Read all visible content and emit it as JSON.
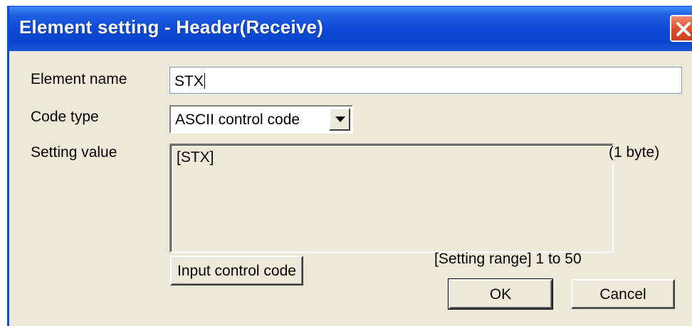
{
  "window": {
    "title": "Element setting - Header(Receive)",
    "close_icon": "close-icon"
  },
  "form": {
    "element_name_label": "Element name",
    "element_name_value": "STX",
    "code_type_label": "Code type",
    "code_type_value": "ASCII control code",
    "setting_value_label": "Setting value",
    "setting_value_text": "[STX]",
    "byte_count": "(1 byte)",
    "setting_range": "[Setting range] 1 to 50"
  },
  "buttons": {
    "input_control_code": "Input control code",
    "ok": "OK",
    "cancel": "Cancel"
  },
  "colors": {
    "titlebar": "#0b4bd6",
    "dialog_bg": "#ece9d8",
    "close_button": "#e0502e"
  }
}
